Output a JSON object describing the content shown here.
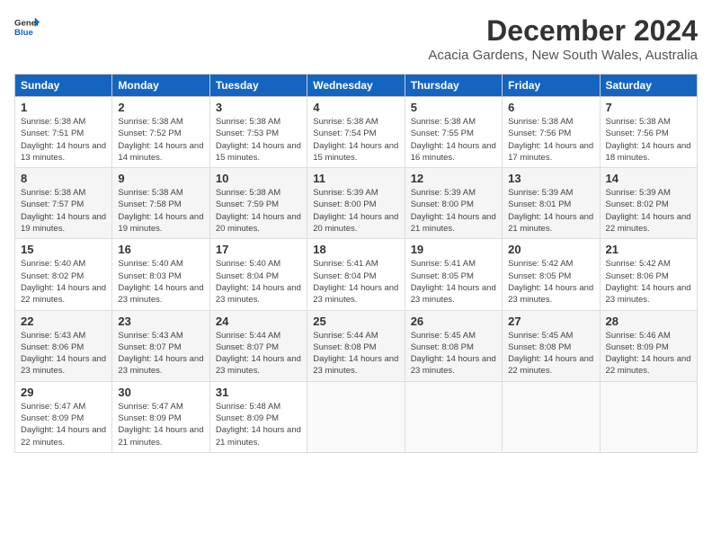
{
  "logo": {
    "line1": "General",
    "line2": "Blue"
  },
  "title": "December 2024",
  "location": "Acacia Gardens, New South Wales, Australia",
  "days_of_week": [
    "Sunday",
    "Monday",
    "Tuesday",
    "Wednesday",
    "Thursday",
    "Friday",
    "Saturday"
  ],
  "weeks": [
    [
      {
        "num": "1",
        "sunrise": "5:38 AM",
        "sunset": "7:51 PM",
        "daylight": "14 hours and 13 minutes."
      },
      {
        "num": "2",
        "sunrise": "5:38 AM",
        "sunset": "7:52 PM",
        "daylight": "14 hours and 14 minutes."
      },
      {
        "num": "3",
        "sunrise": "5:38 AM",
        "sunset": "7:53 PM",
        "daylight": "14 hours and 15 minutes."
      },
      {
        "num": "4",
        "sunrise": "5:38 AM",
        "sunset": "7:54 PM",
        "daylight": "14 hours and 15 minutes."
      },
      {
        "num": "5",
        "sunrise": "5:38 AM",
        "sunset": "7:55 PM",
        "daylight": "14 hours and 16 minutes."
      },
      {
        "num": "6",
        "sunrise": "5:38 AM",
        "sunset": "7:56 PM",
        "daylight": "14 hours and 17 minutes."
      },
      {
        "num": "7",
        "sunrise": "5:38 AM",
        "sunset": "7:56 PM",
        "daylight": "14 hours and 18 minutes."
      }
    ],
    [
      {
        "num": "8",
        "sunrise": "5:38 AM",
        "sunset": "7:57 PM",
        "daylight": "14 hours and 19 minutes."
      },
      {
        "num": "9",
        "sunrise": "5:38 AM",
        "sunset": "7:58 PM",
        "daylight": "14 hours and 19 minutes."
      },
      {
        "num": "10",
        "sunrise": "5:38 AM",
        "sunset": "7:59 PM",
        "daylight": "14 hours and 20 minutes."
      },
      {
        "num": "11",
        "sunrise": "5:39 AM",
        "sunset": "8:00 PM",
        "daylight": "14 hours and 20 minutes."
      },
      {
        "num": "12",
        "sunrise": "5:39 AM",
        "sunset": "8:00 PM",
        "daylight": "14 hours and 21 minutes."
      },
      {
        "num": "13",
        "sunrise": "5:39 AM",
        "sunset": "8:01 PM",
        "daylight": "14 hours and 21 minutes."
      },
      {
        "num": "14",
        "sunrise": "5:39 AM",
        "sunset": "8:02 PM",
        "daylight": "14 hours and 22 minutes."
      }
    ],
    [
      {
        "num": "15",
        "sunrise": "5:40 AM",
        "sunset": "8:02 PM",
        "daylight": "14 hours and 22 minutes."
      },
      {
        "num": "16",
        "sunrise": "5:40 AM",
        "sunset": "8:03 PM",
        "daylight": "14 hours and 23 minutes."
      },
      {
        "num": "17",
        "sunrise": "5:40 AM",
        "sunset": "8:04 PM",
        "daylight": "14 hours and 23 minutes."
      },
      {
        "num": "18",
        "sunrise": "5:41 AM",
        "sunset": "8:04 PM",
        "daylight": "14 hours and 23 minutes."
      },
      {
        "num": "19",
        "sunrise": "5:41 AM",
        "sunset": "8:05 PM",
        "daylight": "14 hours and 23 minutes."
      },
      {
        "num": "20",
        "sunrise": "5:42 AM",
        "sunset": "8:05 PM",
        "daylight": "14 hours and 23 minutes."
      },
      {
        "num": "21",
        "sunrise": "5:42 AM",
        "sunset": "8:06 PM",
        "daylight": "14 hours and 23 minutes."
      }
    ],
    [
      {
        "num": "22",
        "sunrise": "5:43 AM",
        "sunset": "8:06 PM",
        "daylight": "14 hours and 23 minutes."
      },
      {
        "num": "23",
        "sunrise": "5:43 AM",
        "sunset": "8:07 PM",
        "daylight": "14 hours and 23 minutes."
      },
      {
        "num": "24",
        "sunrise": "5:44 AM",
        "sunset": "8:07 PM",
        "daylight": "14 hours and 23 minutes."
      },
      {
        "num": "25",
        "sunrise": "5:44 AM",
        "sunset": "8:08 PM",
        "daylight": "14 hours and 23 minutes."
      },
      {
        "num": "26",
        "sunrise": "5:45 AM",
        "sunset": "8:08 PM",
        "daylight": "14 hours and 23 minutes."
      },
      {
        "num": "27",
        "sunrise": "5:45 AM",
        "sunset": "8:08 PM",
        "daylight": "14 hours and 22 minutes."
      },
      {
        "num": "28",
        "sunrise": "5:46 AM",
        "sunset": "8:09 PM",
        "daylight": "14 hours and 22 minutes."
      }
    ],
    [
      {
        "num": "29",
        "sunrise": "5:47 AM",
        "sunset": "8:09 PM",
        "daylight": "14 hours and 22 minutes."
      },
      {
        "num": "30",
        "sunrise": "5:47 AM",
        "sunset": "8:09 PM",
        "daylight": "14 hours and 21 minutes."
      },
      {
        "num": "31",
        "sunrise": "5:48 AM",
        "sunset": "8:09 PM",
        "daylight": "14 hours and 21 minutes."
      },
      null,
      null,
      null,
      null
    ]
  ]
}
